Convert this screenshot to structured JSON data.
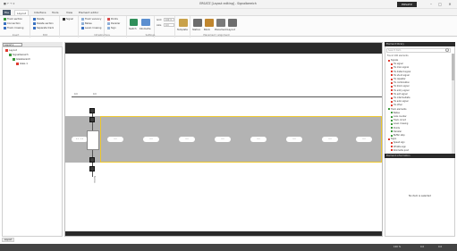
{
  "window": {
    "title": "ERSATZ [Layout editing] - Signalbereich",
    "quick_access": "■ ↶ ↷ ▾",
    "brand": "ERSATZ",
    "controls": [
      "–",
      "□",
      "✕"
    ]
  },
  "tabs": [
    {
      "label": "File"
    },
    {
      "label": "Layout"
    },
    {
      "label": "Interface"
    },
    {
      "label": "Tools"
    },
    {
      "label": "View"
    },
    {
      "label": "Element editor"
    }
  ],
  "ribbon": {
    "groups": [
      {
        "label": "Insert",
        "items": [
          "Track section",
          "Connection",
          "Track crossing"
        ]
      },
      {
        "label": "Edit",
        "items": [
          "Delete",
          "Delete section",
          "Separate track"
        ]
      },
      {
        "label": "",
        "items": [
          "Signal"
        ]
      },
      {
        "label": "Infrastructure",
        "items": [
          "Track vacancy",
          "Balise",
          "Level crossing"
        ]
      },
      {
        "label": "",
        "items": [
          "Points",
          "Derailer",
          "Sign"
        ]
      },
      {
        "label": "Settings",
        "items": [
          "Switch",
          "Kilometre"
        ]
      },
      {
        "label": "",
        "items": [
          "Grid",
          "Axis"
        ]
      },
      {
        "label": "Template",
        "items": [
          "Template"
        ]
      },
      {
        "label": "Placement / alignment",
        "items": [
          "Station",
          "Block",
          "Placement",
          "Layout"
        ]
      }
    ],
    "field_values": [
      "100 m",
      "0.0"
    ]
  },
  "left_panel": {
    "header": "Layout ▾",
    "tree": [
      {
        "label": "Layout",
        "depth": 0,
        "color": "#e03a2e"
      },
      {
        "label": "Signalbereich",
        "depth": 1,
        "color": "#3c9a3c"
      },
      {
        "label": "Gleisbereich",
        "depth": 2,
        "color": "#3c9a3c"
      },
      {
        "label": "Gleis 1",
        "depth": 3,
        "color": "#e03a2e"
      }
    ]
  },
  "canvas": {
    "top_labels": [
      "0.0",
      "0.0"
    ],
    "pill_labels": [
      "0.0 - 0.0",
      "0.0",
      "0.0",
      "0.0",
      "0.0",
      "0.0",
      "0.0",
      "0.0",
      "0.0"
    ],
    "vertical_label": "Station"
  },
  "right_panel": {
    "header": "Element library",
    "search_placeholder": "Search item",
    "category": "Found 100 elements",
    "items": [
      {
        "label": "Signals",
        "color": "#e03a2e"
      },
      {
        "label": "HL signal",
        "color": "#e03a2e"
      },
      {
        "label": "HL main signal",
        "color": "#e03a2e"
      },
      {
        "label": "HL distant signal",
        "color": "#e03a2e"
      },
      {
        "label": "HL shunt signal",
        "color": "#e03a2e"
      },
      {
        "label": "HL repeater",
        "color": "#e03a2e"
      },
      {
        "label": "HL combination",
        "color": "#e03a2e"
      },
      {
        "label": "HL block signal",
        "color": "#e03a2e"
      },
      {
        "label": "HL entry signal",
        "color": "#e03a2e"
      },
      {
        "label": "HL exit signal",
        "color": "#e03a2e"
      },
      {
        "label": "HL intermediate",
        "color": "#e03a2e"
      },
      {
        "label": "HL auto signal",
        "color": "#e03a2e"
      },
      {
        "label": "HL other",
        "color": "#e03a2e"
      },
      {
        "label": "Track elements",
        "color": "#3c9a3c"
      },
      {
        "label": "Balise",
        "color": "#3c9a3c"
      },
      {
        "label": "Axle counter",
        "color": "#3c9a3c"
      },
      {
        "label": "Track circuit",
        "color": "#3c9a3c"
      },
      {
        "label": "Level crossing",
        "color": "#3c9a3c"
      },
      {
        "label": "Points",
        "color": "#3c9a3c"
      },
      {
        "label": "Derailer",
        "color": "#3c9a3c"
      },
      {
        "label": "Buffer stop",
        "color": "#3c9a3c"
      },
      {
        "label": "Signs",
        "color": "#e03a2e"
      },
      {
        "label": "Speed sign",
        "color": "#e03a2e"
      },
      {
        "label": "Whistle sign",
        "color": "#e03a2e"
      },
      {
        "label": "Kilometre post",
        "color": "#e03a2e"
      }
    ],
    "properties_header": "Element information",
    "properties_message": "No item is selected"
  },
  "bottom": {
    "tab_label": "Layout",
    "status_items": [
      "",
      "100 %",
      "0.0",
      "0.0"
    ]
  },
  "colors": {
    "road": "#b3b3b3",
    "highlight": "#ecc62e",
    "dark_bar": "#2a2a2a"
  }
}
